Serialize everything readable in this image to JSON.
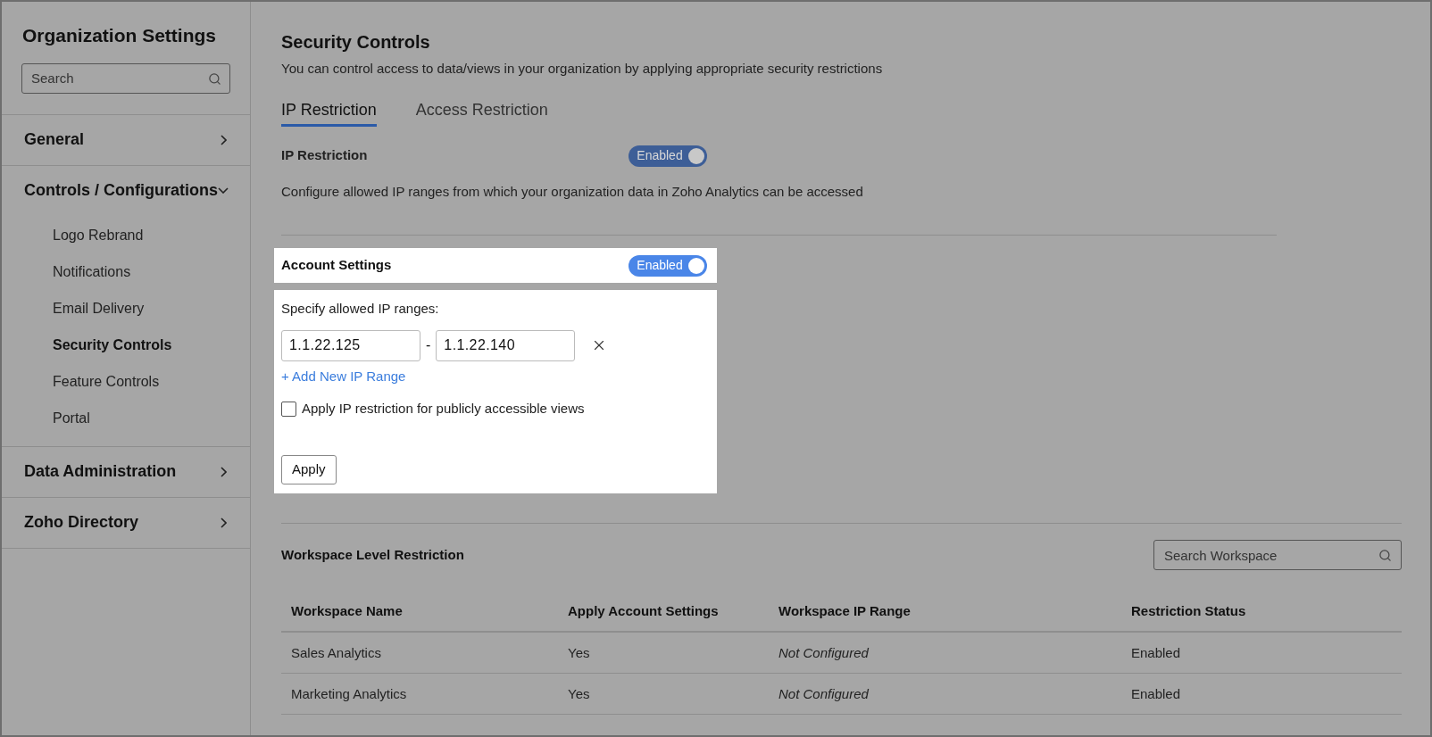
{
  "sidebar": {
    "title": "Organization Settings",
    "search": {
      "placeholder": "Search"
    },
    "sections": [
      {
        "label": "General",
        "expanded": false
      },
      {
        "label": "Controls / Configurations",
        "expanded": true,
        "children": [
          {
            "label": "Logo Rebrand",
            "selected": false
          },
          {
            "label": "Notifications",
            "selected": false
          },
          {
            "label": "Email Delivery",
            "selected": false
          },
          {
            "label": "Security Controls",
            "selected": true
          },
          {
            "label": "Feature Controls",
            "selected": false
          },
          {
            "label": "Portal",
            "selected": false
          }
        ]
      },
      {
        "label": "Data Administration",
        "expanded": false
      },
      {
        "label": "Zoho Directory",
        "expanded": false
      }
    ]
  },
  "main": {
    "title": "Security Controls",
    "subtitle": "You can control access to data/views in your organization by applying appropriate security restrictions",
    "tabs": [
      {
        "label": "IP Restriction",
        "selected": true
      },
      {
        "label": "Access Restriction",
        "selected": false
      }
    ],
    "ip_restriction": {
      "label": "IP Restriction",
      "toggle": {
        "label": "Enabled",
        "on": true
      }
    },
    "description": "Configure allowed IP ranges from which your organization data in Zoho Analytics can be accessed",
    "account_settings": {
      "label": "Account Settings",
      "toggle": {
        "label": "Enabled",
        "on": true
      }
    },
    "ip_ranges": {
      "label": "Specify allowed IP ranges:",
      "ranges": [
        {
          "from": "1.1.22.125",
          "separator": "-",
          "to": "1.1.22.140"
        }
      ],
      "add_link": "+ Add New IP Range",
      "checkbox": {
        "label": "Apply IP restriction for publicly accessible views",
        "checked": false
      },
      "apply_button": "Apply"
    },
    "workspace": {
      "title": "Workspace Level Restriction",
      "search": {
        "placeholder": "Search Workspace"
      },
      "columns": [
        "Workspace Name",
        "Apply Account Settings",
        "Workspace IP Range",
        "Restriction Status"
      ],
      "rows": [
        [
          "Sales Analytics",
          "Yes",
          "Not Configured",
          "Enabled"
        ],
        [
          "Marketing Analytics",
          "Yes",
          "Not Configured",
          "Enabled"
        ]
      ]
    }
  }
}
